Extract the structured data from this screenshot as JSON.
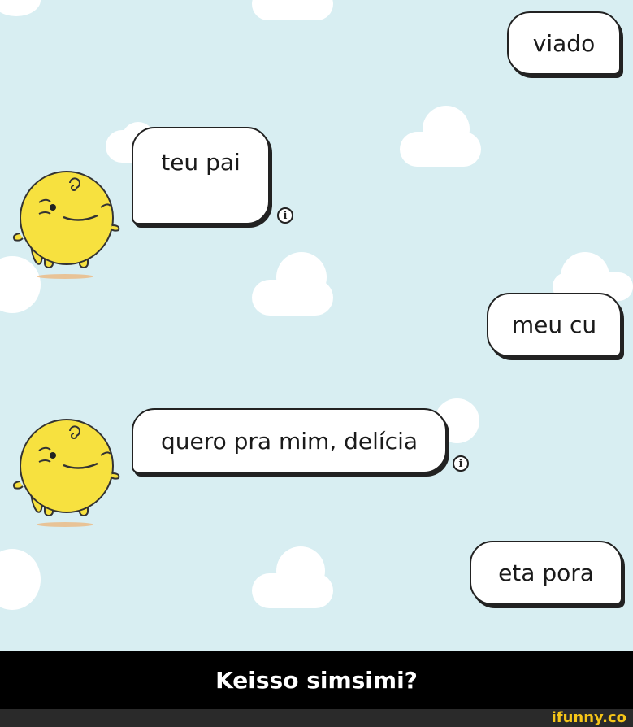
{
  "chat": {
    "messages": [
      {
        "sender": "user",
        "text": "viado"
      },
      {
        "sender": "bot",
        "text": "teu pai"
      },
      {
        "sender": "user",
        "text": "meu cu"
      },
      {
        "sender": "bot",
        "text": "quero pra mim, delícia"
      },
      {
        "sender": "user",
        "text": "eta pora"
      }
    ],
    "info_icon": "info-circle-icon",
    "bot_avatar_icon": "simsimi-character-icon"
  },
  "caption": {
    "text": "Keisso simsimi?"
  },
  "watermark": {
    "text": "ifunny.co"
  },
  "colors": {
    "sky_background": "#d8eef2",
    "bubble_fill": "#ffffff",
    "bubble_border": "#222222",
    "avatar_yellow": "#f7e13f",
    "caption_bar": "#000000",
    "watermark": "#f5c518"
  }
}
